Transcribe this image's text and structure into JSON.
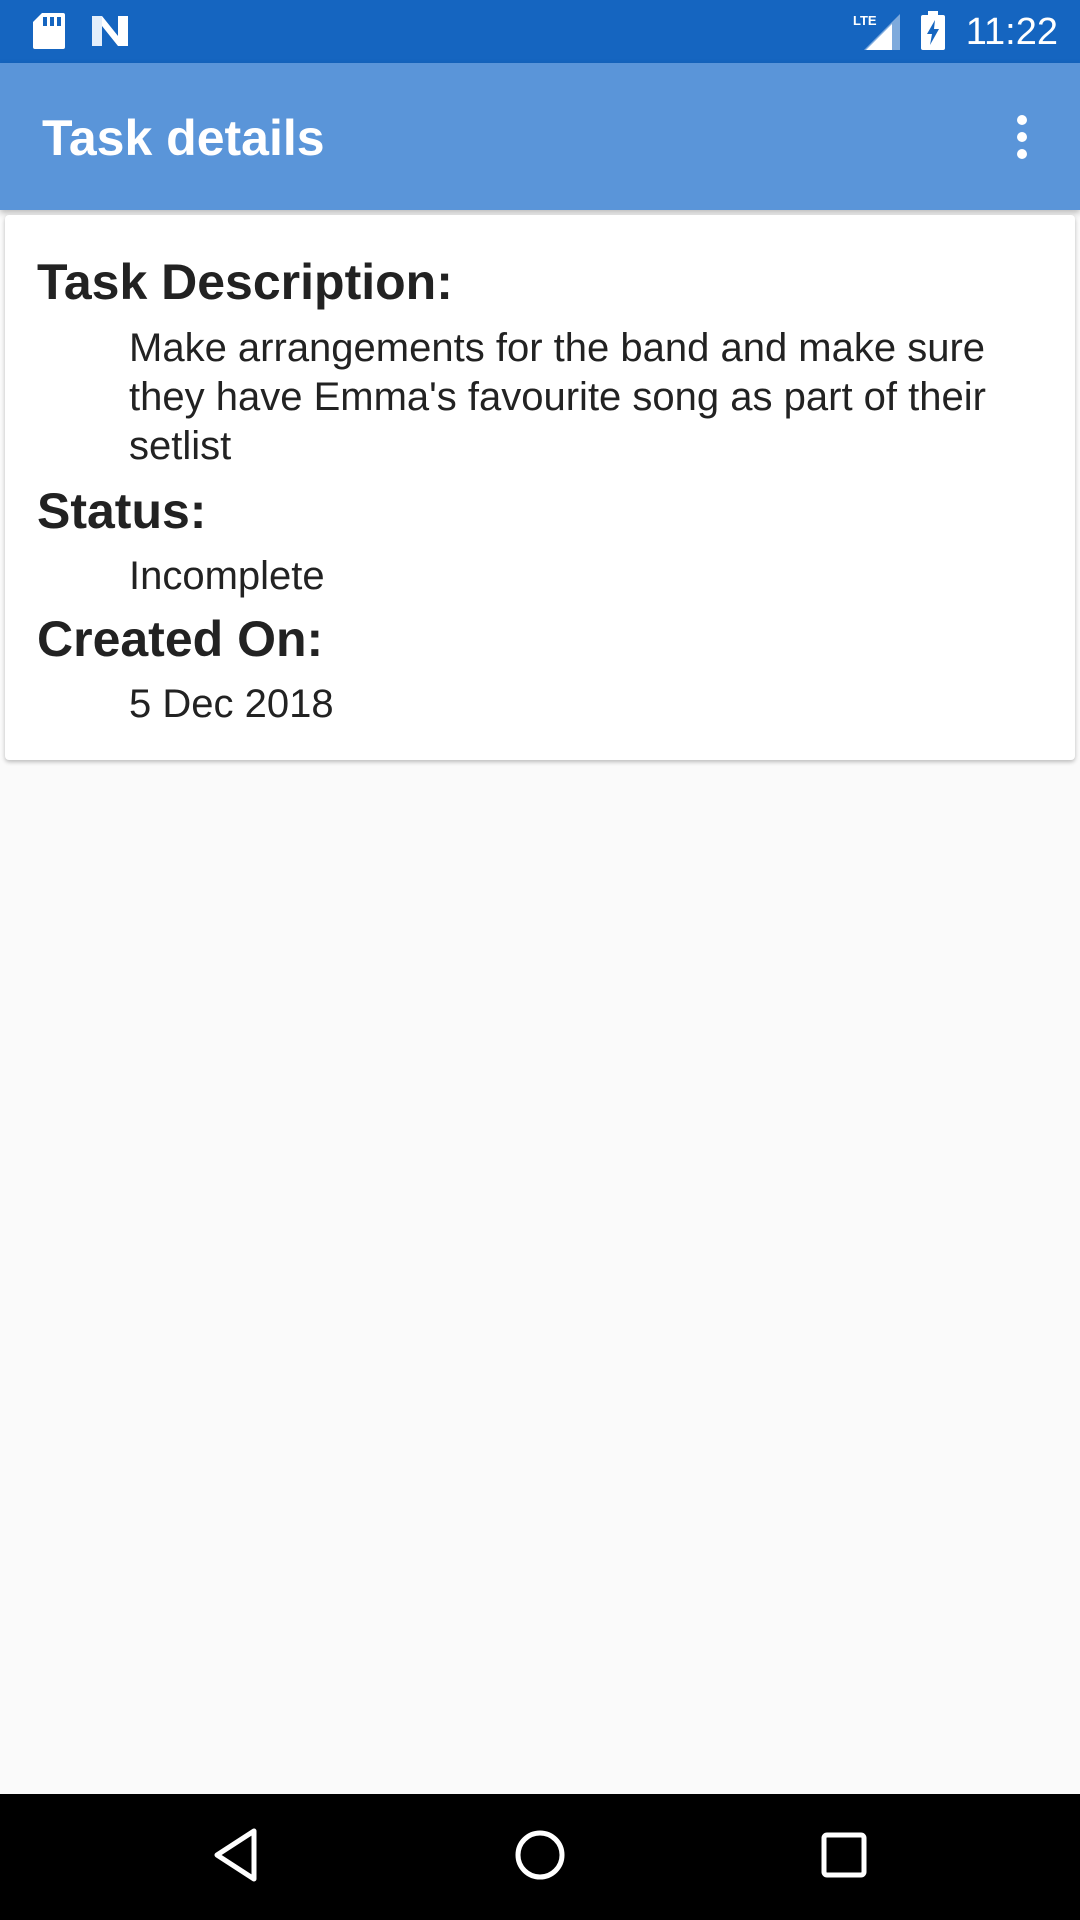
{
  "status_bar": {
    "time": "11:22",
    "icons": [
      "sd-card-icon",
      "n-notification-icon",
      "lte-signal-icon",
      "battery-charging-icon"
    ],
    "lte_label": "LTE"
  },
  "app_bar": {
    "title": "Task details",
    "menu_icon": "overflow-menu-icon",
    "background": "#5a95d9"
  },
  "task": {
    "description_label": "Task Description:",
    "description": "Make arrangements for the band and make sure they have Emma's favourite song as part of their setlist",
    "status_label": "Status:",
    "status": "Incomplete",
    "created_label": "Created On:",
    "created_on": "5 Dec 2018"
  },
  "nav_bar": {
    "buttons": [
      "back-icon",
      "home-icon",
      "recents-icon"
    ]
  }
}
